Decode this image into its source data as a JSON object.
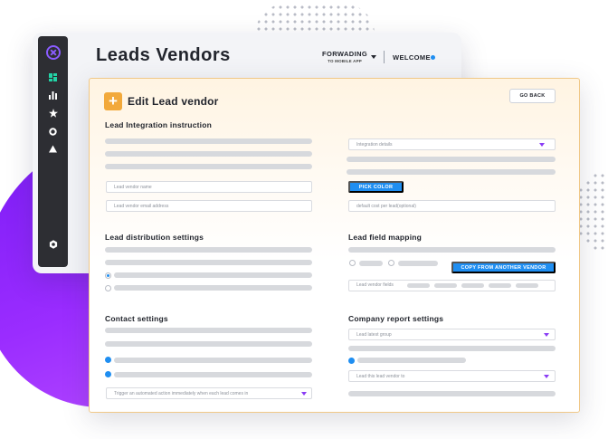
{
  "header": {
    "title": "Leads Vendors",
    "forwarding_label": "FORWADING",
    "forwarding_sublabel": "TO MOBILE APP",
    "welcome_label": "WELCOME"
  },
  "sidebar": {
    "icons": [
      "logo-icon",
      "dashboard-icon",
      "bar-chart-icon",
      "star-icon",
      "circle-icon",
      "triangle-icon",
      "settings-icon"
    ]
  },
  "card": {
    "title": "Edit Lead vendor",
    "add_symbol": "+",
    "go_back_label": "GO BACK"
  },
  "lead_integration": {
    "title": "Lead Integration instruction",
    "integration_select": "Integration details",
    "vendor_name_placeholder": "Lead vendor name",
    "vendor_email_placeholder": "Lead vendor email address",
    "pick_color_label": "PICK COLOR",
    "default_cost_placeholder": "default cost per lead(optional)"
  },
  "lead_distribution": {
    "title": "Lead distribution settings"
  },
  "lead_field_mapping": {
    "title": "Lead field mapping",
    "copy_button_label": "COPY FROM ANOTHER VENDOR",
    "vendor_fields_label": "Lead vendor fields"
  },
  "contact_settings": {
    "title": "Contact settings",
    "trigger_select": "Trigger an automated action immediately when each lead comes in"
  },
  "company_report": {
    "title": "Company report settings",
    "latest_group_select": "Lead latest group",
    "link_vendor_select": "Lead this lead vendor to"
  },
  "colors": {
    "accent_purple": "#8a3cf5",
    "primary_blue": "#1f8ef1",
    "accent_orange": "#f2a93b",
    "sidebar_dark": "#2d2e33"
  }
}
